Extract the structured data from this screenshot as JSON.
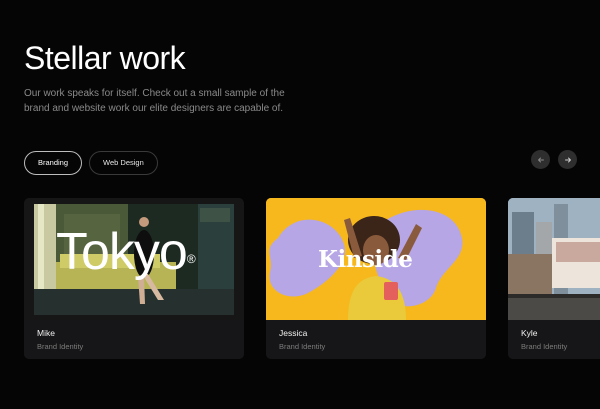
{
  "header": {
    "title": "Stellar work",
    "subtitle": "Our work speaks for itself. Check out a small sample of the brand and website work our elite designers are capable of."
  },
  "filters": [
    {
      "label": "Branding",
      "active": true
    },
    {
      "label": "Web Design",
      "active": false
    }
  ],
  "carousel_nav": {
    "prev_icon": "arrow-left-icon",
    "next_icon": "arrow-right-icon"
  },
  "cards": [
    {
      "image_text": "Tokyo",
      "image_mark": "®",
      "name": "Mike",
      "role": "Brand Identity"
    },
    {
      "image_text": "Kinside",
      "name": "Jessica",
      "role": "Brand Identity"
    },
    {
      "name": "Kyle",
      "role": "Brand Identity"
    }
  ],
  "colors": {
    "background": "#050505",
    "card_meta": "#161618",
    "kinside_yellow": "#f6b81c",
    "kinside_lavender": "#b6a6e6"
  }
}
